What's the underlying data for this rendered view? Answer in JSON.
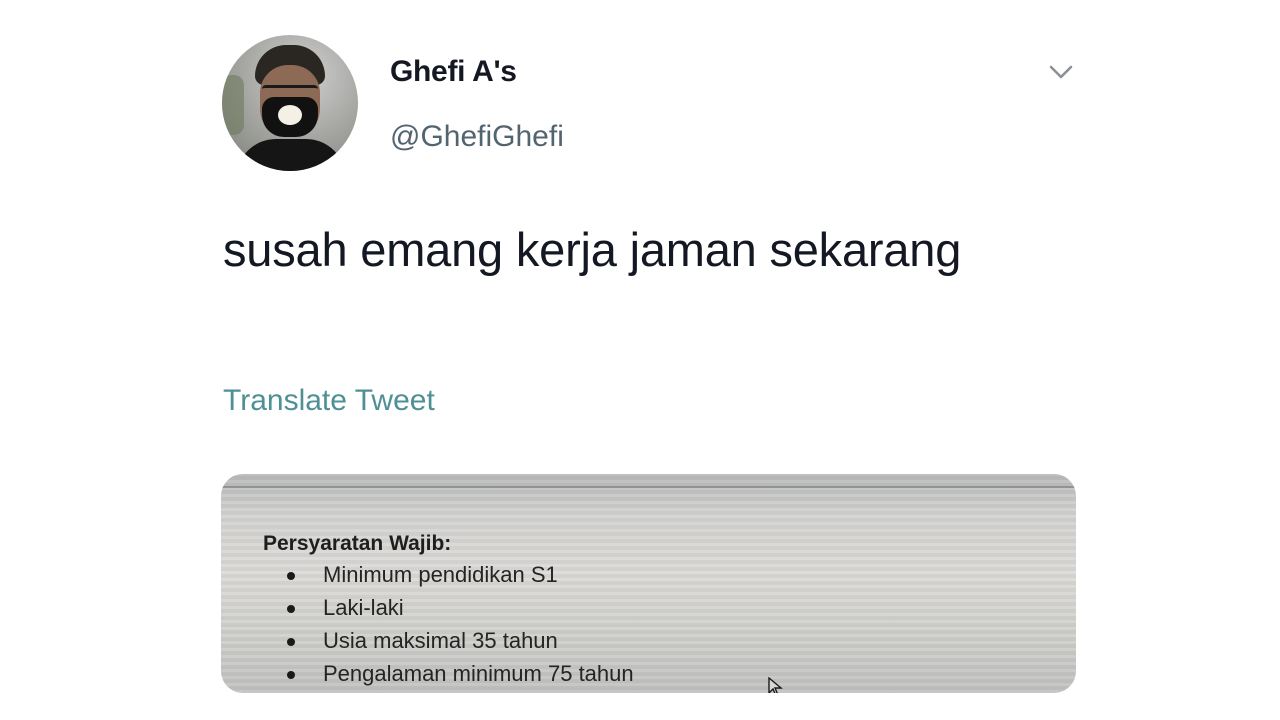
{
  "user": {
    "name": "Ghefi A's",
    "handle": "@GhefiGhefi"
  },
  "tweet": {
    "text": "susah emang kerja jaman sekarang",
    "translate_label": "Translate Tweet"
  },
  "media": {
    "heading": "Persyaratan Wajib:",
    "items": [
      "Minimum pendidikan S1",
      "Laki-laki",
      "Usia maksimal 35 tahun",
      "Pengalaman minimum 75 tahun"
    ]
  },
  "icons": {
    "menu": "chevron-down-icon",
    "cursor": "mouse-pointer-icon"
  },
  "colors": {
    "text": "#141823",
    "handle": "#536471",
    "translate": "#4f8f96"
  }
}
